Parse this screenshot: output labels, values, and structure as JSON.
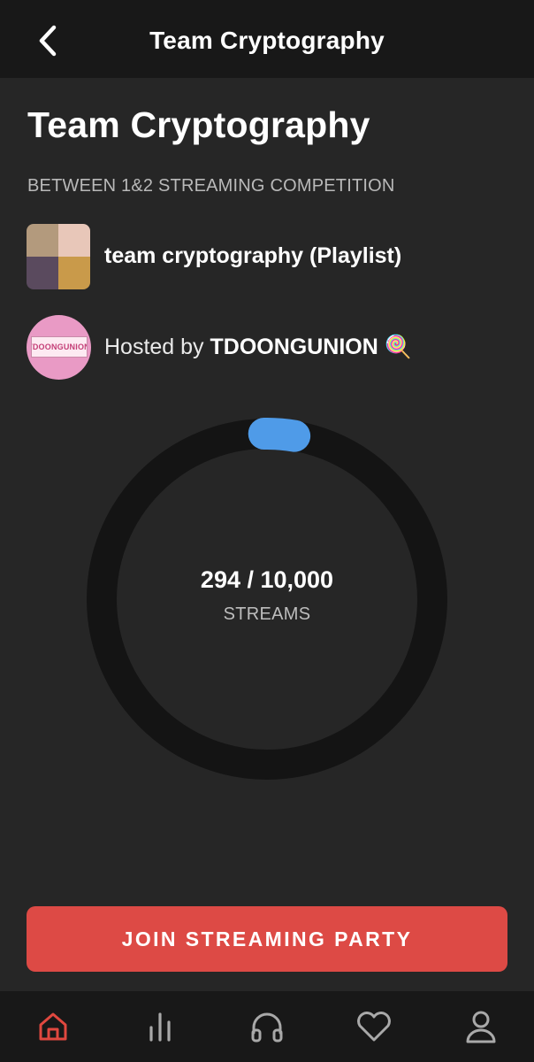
{
  "header": {
    "title": "Team Cryptography",
    "back_icon": "chevron-left-icon"
  },
  "page": {
    "title": "Team Cryptography",
    "subtitle": "BETWEEN 1&2 STREAMING COMPETITION"
  },
  "playlist": {
    "label": "team cryptography (Playlist)"
  },
  "host": {
    "prefix": "Hosted by ",
    "name": "TDOONGUNION",
    "emoji": "🍭",
    "avatar_text": "TDOONGUNION"
  },
  "progress": {
    "count": "294 / 10,000",
    "unit": "STREAMS",
    "current": 294,
    "goal": 10000,
    "color": "#4f9be8"
  },
  "cta": {
    "label": "JOIN STREAMING PARTY",
    "color": "#dd4a45"
  },
  "nav": {
    "active_color": "#e0483f",
    "items": [
      {
        "icon": "home-icon",
        "active": true
      },
      {
        "icon": "chart-bars-icon",
        "active": false
      },
      {
        "icon": "headphones-icon",
        "active": false
      },
      {
        "icon": "heart-icon",
        "active": false
      },
      {
        "icon": "profile-icon",
        "active": false
      }
    ]
  }
}
